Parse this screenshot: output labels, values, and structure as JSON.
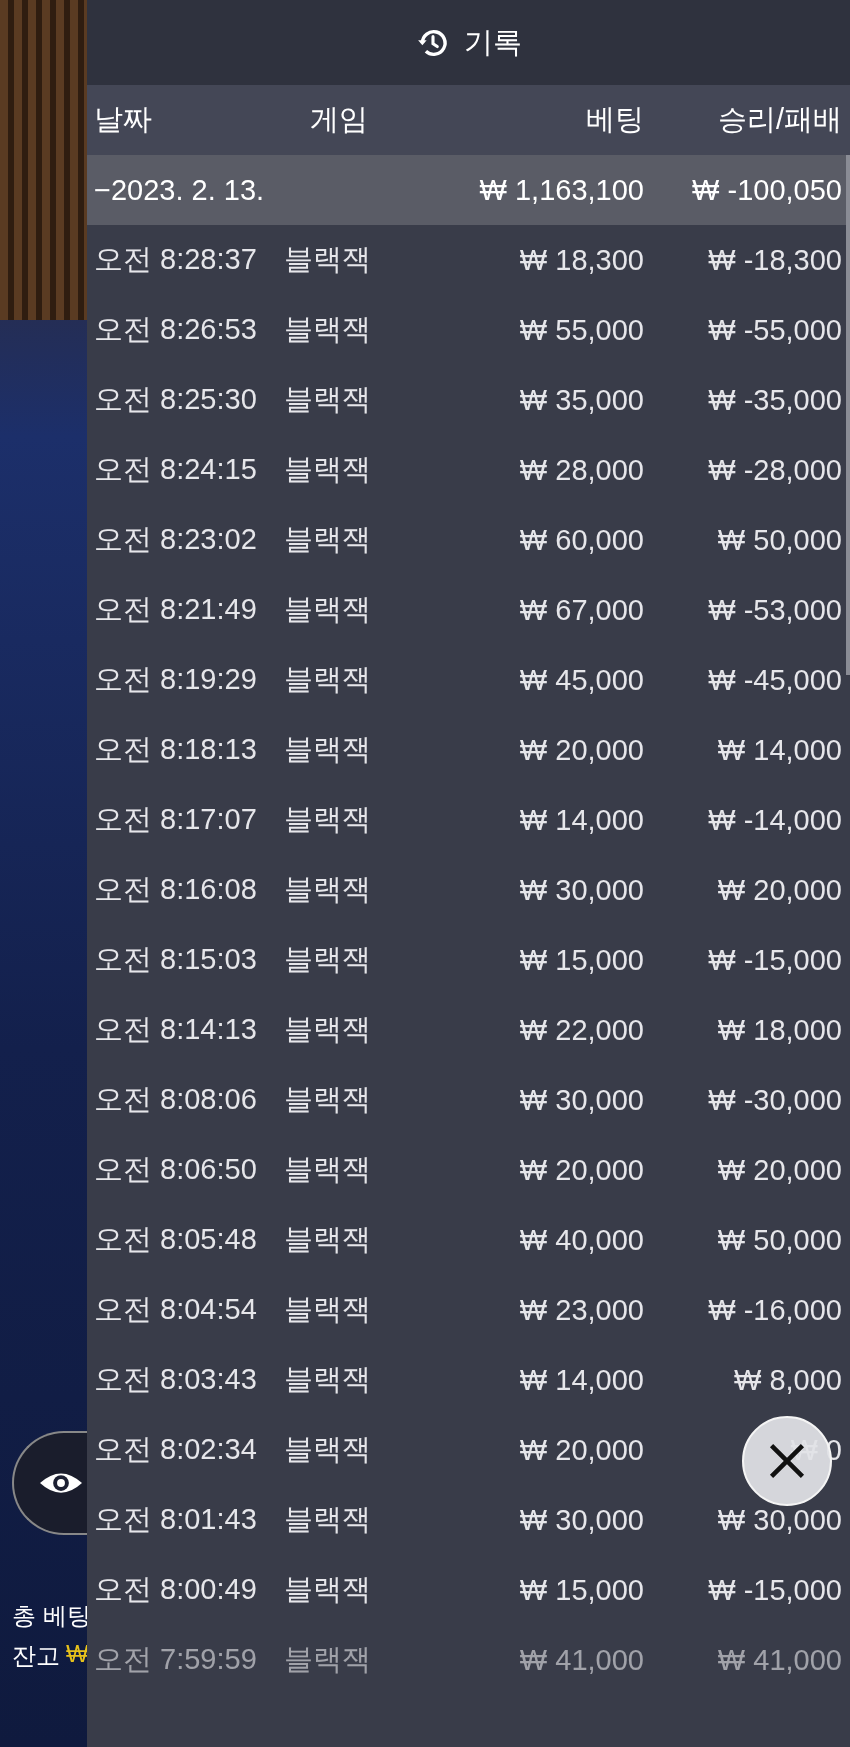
{
  "background": {
    "total_bet_label": "총 베팅",
    "balance_label": "잔고",
    "balance_currency": "₩"
  },
  "panel": {
    "title": "기록",
    "columns": [
      "날짜",
      "게임",
      "베팅",
      "승리/패배"
    ],
    "date_group": {
      "date": "−2023. 2. 13.",
      "bet": "₩ 1,163,100",
      "result": "₩ -100,050"
    },
    "rows": [
      {
        "time": "오전 8:28:37",
        "game": "블랙잭",
        "bet": "₩ 18,300",
        "result": "₩ -18,300"
      },
      {
        "time": "오전 8:26:53",
        "game": "블랙잭",
        "bet": "₩ 55,000",
        "result": "₩ -55,000"
      },
      {
        "time": "오전 8:25:30",
        "game": "블랙잭",
        "bet": "₩ 35,000",
        "result": "₩ -35,000"
      },
      {
        "time": "오전 8:24:15",
        "game": "블랙잭",
        "bet": "₩ 28,000",
        "result": "₩ -28,000"
      },
      {
        "time": "오전 8:23:02",
        "game": "블랙잭",
        "bet": "₩ 60,000",
        "result": "₩ 50,000"
      },
      {
        "time": "오전 8:21:49",
        "game": "블랙잭",
        "bet": "₩ 67,000",
        "result": "₩ -53,000"
      },
      {
        "time": "오전 8:19:29",
        "game": "블랙잭",
        "bet": "₩ 45,000",
        "result": "₩ -45,000"
      },
      {
        "time": "오전 8:18:13",
        "game": "블랙잭",
        "bet": "₩ 20,000",
        "result": "₩ 14,000"
      },
      {
        "time": "오전 8:17:07",
        "game": "블랙잭",
        "bet": "₩ 14,000",
        "result": "₩ -14,000"
      },
      {
        "time": "오전 8:16:08",
        "game": "블랙잭",
        "bet": "₩ 30,000",
        "result": "₩ 20,000"
      },
      {
        "time": "오전 8:15:03",
        "game": "블랙잭",
        "bet": "₩ 15,000",
        "result": "₩ -15,000"
      },
      {
        "time": "오전 8:14:13",
        "game": "블랙잭",
        "bet": "₩ 22,000",
        "result": "₩ 18,000"
      },
      {
        "time": "오전 8:08:06",
        "game": "블랙잭",
        "bet": "₩ 30,000",
        "result": "₩ -30,000"
      },
      {
        "time": "오전 8:06:50",
        "game": "블랙잭",
        "bet": "₩ 20,000",
        "result": "₩ 20,000"
      },
      {
        "time": "오전 8:05:48",
        "game": "블랙잭",
        "bet": "₩ 40,000",
        "result": "₩ 50,000"
      },
      {
        "time": "오전 8:04:54",
        "game": "블랙잭",
        "bet": "₩ 23,000",
        "result": "₩ -16,000"
      },
      {
        "time": "오전 8:03:43",
        "game": "블랙잭",
        "bet": "₩ 14,000",
        "result": "₩ 8,000"
      },
      {
        "time": "오전 8:02:34",
        "game": "블랙잭",
        "bet": "₩ 20,000",
        "result": "₩ 0"
      },
      {
        "time": "오전 8:01:43",
        "game": "블랙잭",
        "bet": "₩ 30,000",
        "result": "₩ 30,000"
      },
      {
        "time": "오전 8:00:49",
        "game": "블랙잭",
        "bet": "₩ 15,000",
        "result": "₩ -15,000"
      },
      {
        "time": "오전 7:59:59",
        "game": "블랙잭",
        "bet": "₩ 41,000",
        "result": "₩ 41,000"
      }
    ]
  }
}
